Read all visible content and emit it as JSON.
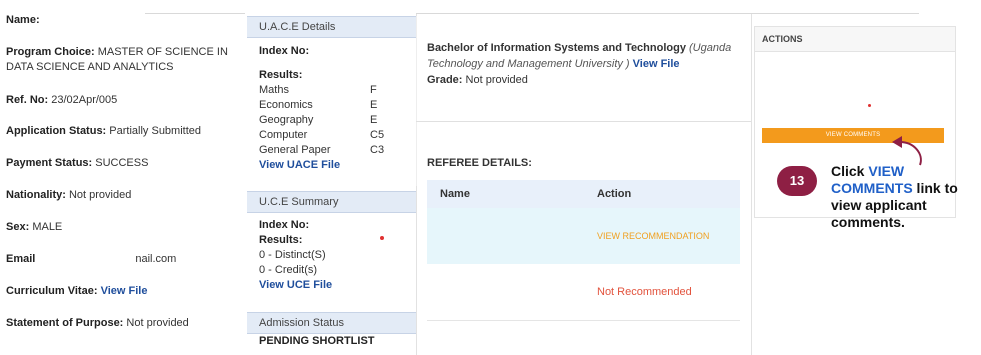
{
  "applicant": {
    "name_label": "Name:",
    "name_value": "",
    "program_label": "Program  Choice:",
    "program_value": "MASTER OF SCIENCE IN DATA SCIENCE AND ANALYTICS",
    "ref_label": "Ref. No:",
    "ref_value": "23/02Apr/005",
    "app_status_label": "Application Status:",
    "app_status_value": "Partially Submitted",
    "payment_label": "Payment Status:",
    "payment_value": "SUCCESS",
    "nationality_label": "Nationality:",
    "nationality_value": "Not provided",
    "sex_label": "Sex:",
    "sex_value": "MALE",
    "email_label": "Email",
    "email_value": "nail.com",
    "cv_label": "Curriculum Vitae:",
    "cv_link": "View File",
    "sop_label": "Statement of Purpose:",
    "sop_value": "Not provided"
  },
  "uace": {
    "title": "U.A.C.E Details",
    "index_label": "Index No:",
    "results_label": "Results:",
    "subjects": [
      {
        "name": "Maths",
        "grade": "F"
      },
      {
        "name": "Economics",
        "grade": "E"
      },
      {
        "name": "Geography",
        "grade": "E"
      },
      {
        "name": "Computer",
        "grade": "C5"
      },
      {
        "name": "General Paper",
        "grade": "C3"
      }
    ],
    "link": "View UACE File"
  },
  "uce": {
    "title": "U.C.E Summary",
    "index_label": "Index No:",
    "results_label": "Results:",
    "distinct": "0 - Distinct(S)",
    "credit": "0 - Credit(s)",
    "link": "View UCE File"
  },
  "admission": {
    "title": "Admission Status",
    "status": "PENDING SHORTLIST"
  },
  "qualification": {
    "degree": "Bachelor of Information Systems and Technology",
    "institution": "(Uganda Technology and Management University )",
    "link": "View File",
    "grade_label": "Grade:",
    "grade_value": "Not provided"
  },
  "referee": {
    "title": "REFEREE DETAILS:",
    "col_name": "Name",
    "col_action": "Action",
    "rows": [
      {
        "name": "",
        "action": "VIEW RECOMMENDATION"
      },
      {
        "name": "",
        "action": "Not Recommended"
      }
    ]
  },
  "actions": {
    "title": "ACTIONS",
    "button": "VIEW COMMENTS"
  },
  "callout": {
    "step": "13",
    "text_before": "Click ",
    "link_text": "VIEW COMMENTS",
    "text_after": " link to view applicant comments."
  }
}
